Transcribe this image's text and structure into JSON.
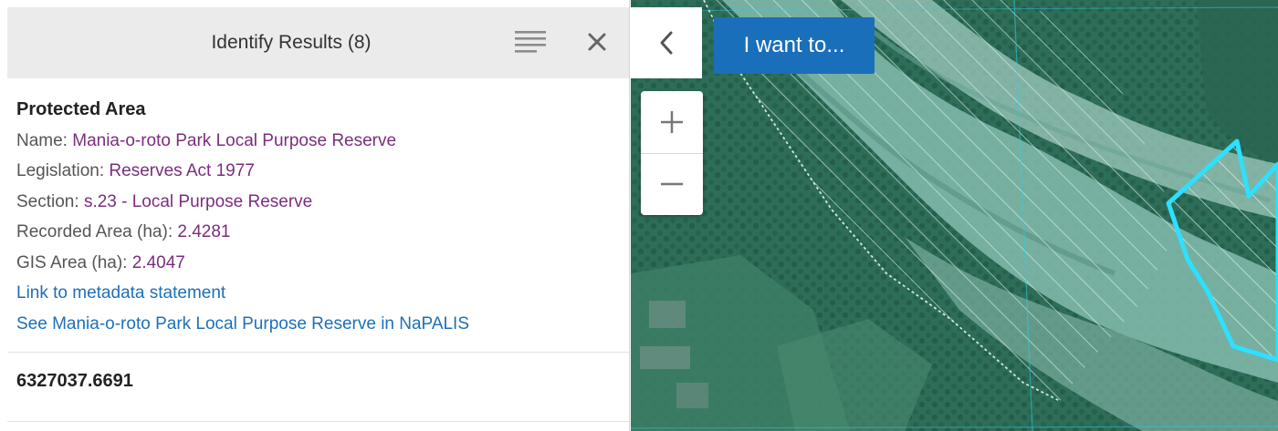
{
  "panel": {
    "title": "Identify Results (8)",
    "list_icon": "list-icon",
    "close_icon": "close-icon"
  },
  "result": {
    "title": "Protected Area",
    "name_label": "Name: ",
    "name_value": "Mania-o-roto Park Local Purpose Reserve",
    "legislation_label": "Legislation: ",
    "legislation_value": "Reserves Act 1977",
    "section_label": "Section: ",
    "section_value": "s.23 - Local Purpose Reserve",
    "recorded_area_label": "Recorded Area (ha): ",
    "recorded_area_value": "2.4281",
    "gis_area_label": "GIS Area (ha): ",
    "gis_area_value": "2.4047",
    "link_metadata": "Link to metadata statement",
    "link_napalis": "See Mania-o-roto Park Local Purpose Reserve in NaPALIS"
  },
  "result2": {
    "title": "6327037.6691"
  },
  "map": {
    "collapse_icon": "chevron-left-icon",
    "i_want_to_label": "I want to...",
    "zoom_in_icon": "plus-icon",
    "zoom_out_icon": "minus-icon"
  },
  "colors": {
    "header_bg": "#ebebeb",
    "attr_value": "#7b2d7e",
    "link": "#1d70b8",
    "button_blue": "#1a6fba",
    "highlight_outline": "#2ee0ff"
  }
}
